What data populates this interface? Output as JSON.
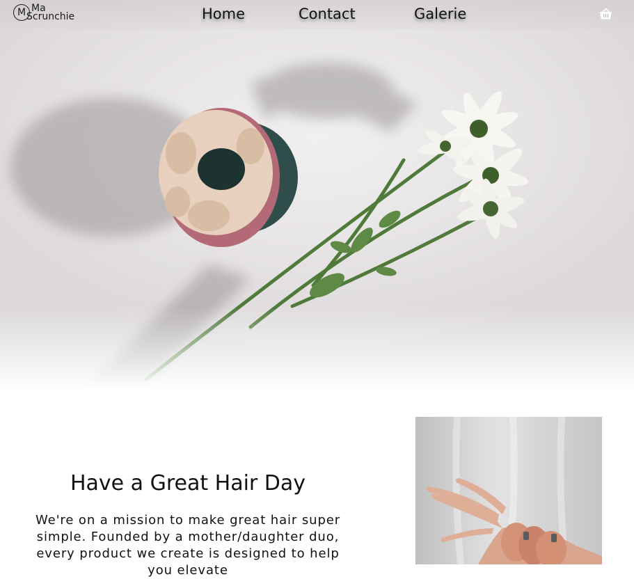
{
  "brand": {
    "logo_initial": "M",
    "logo_line1": "Ma",
    "logo_line2": "Scrunchie"
  },
  "nav": {
    "items": [
      {
        "label": "Home"
      },
      {
        "label": "Contact"
      },
      {
        "label": "Galerie"
      }
    ],
    "cart_icon": "basket-icon"
  },
  "hero": {
    "image": "scrunchie-and-daisies-photo"
  },
  "about": {
    "title": "Have a Great Hair Day",
    "text": "We're on a mission to make great hair super simple. Founded by a mother/daughter duo, every product we create is designed to help you elevate"
  },
  "photo": {
    "image": "hand-with-scrunchies-photo"
  }
}
